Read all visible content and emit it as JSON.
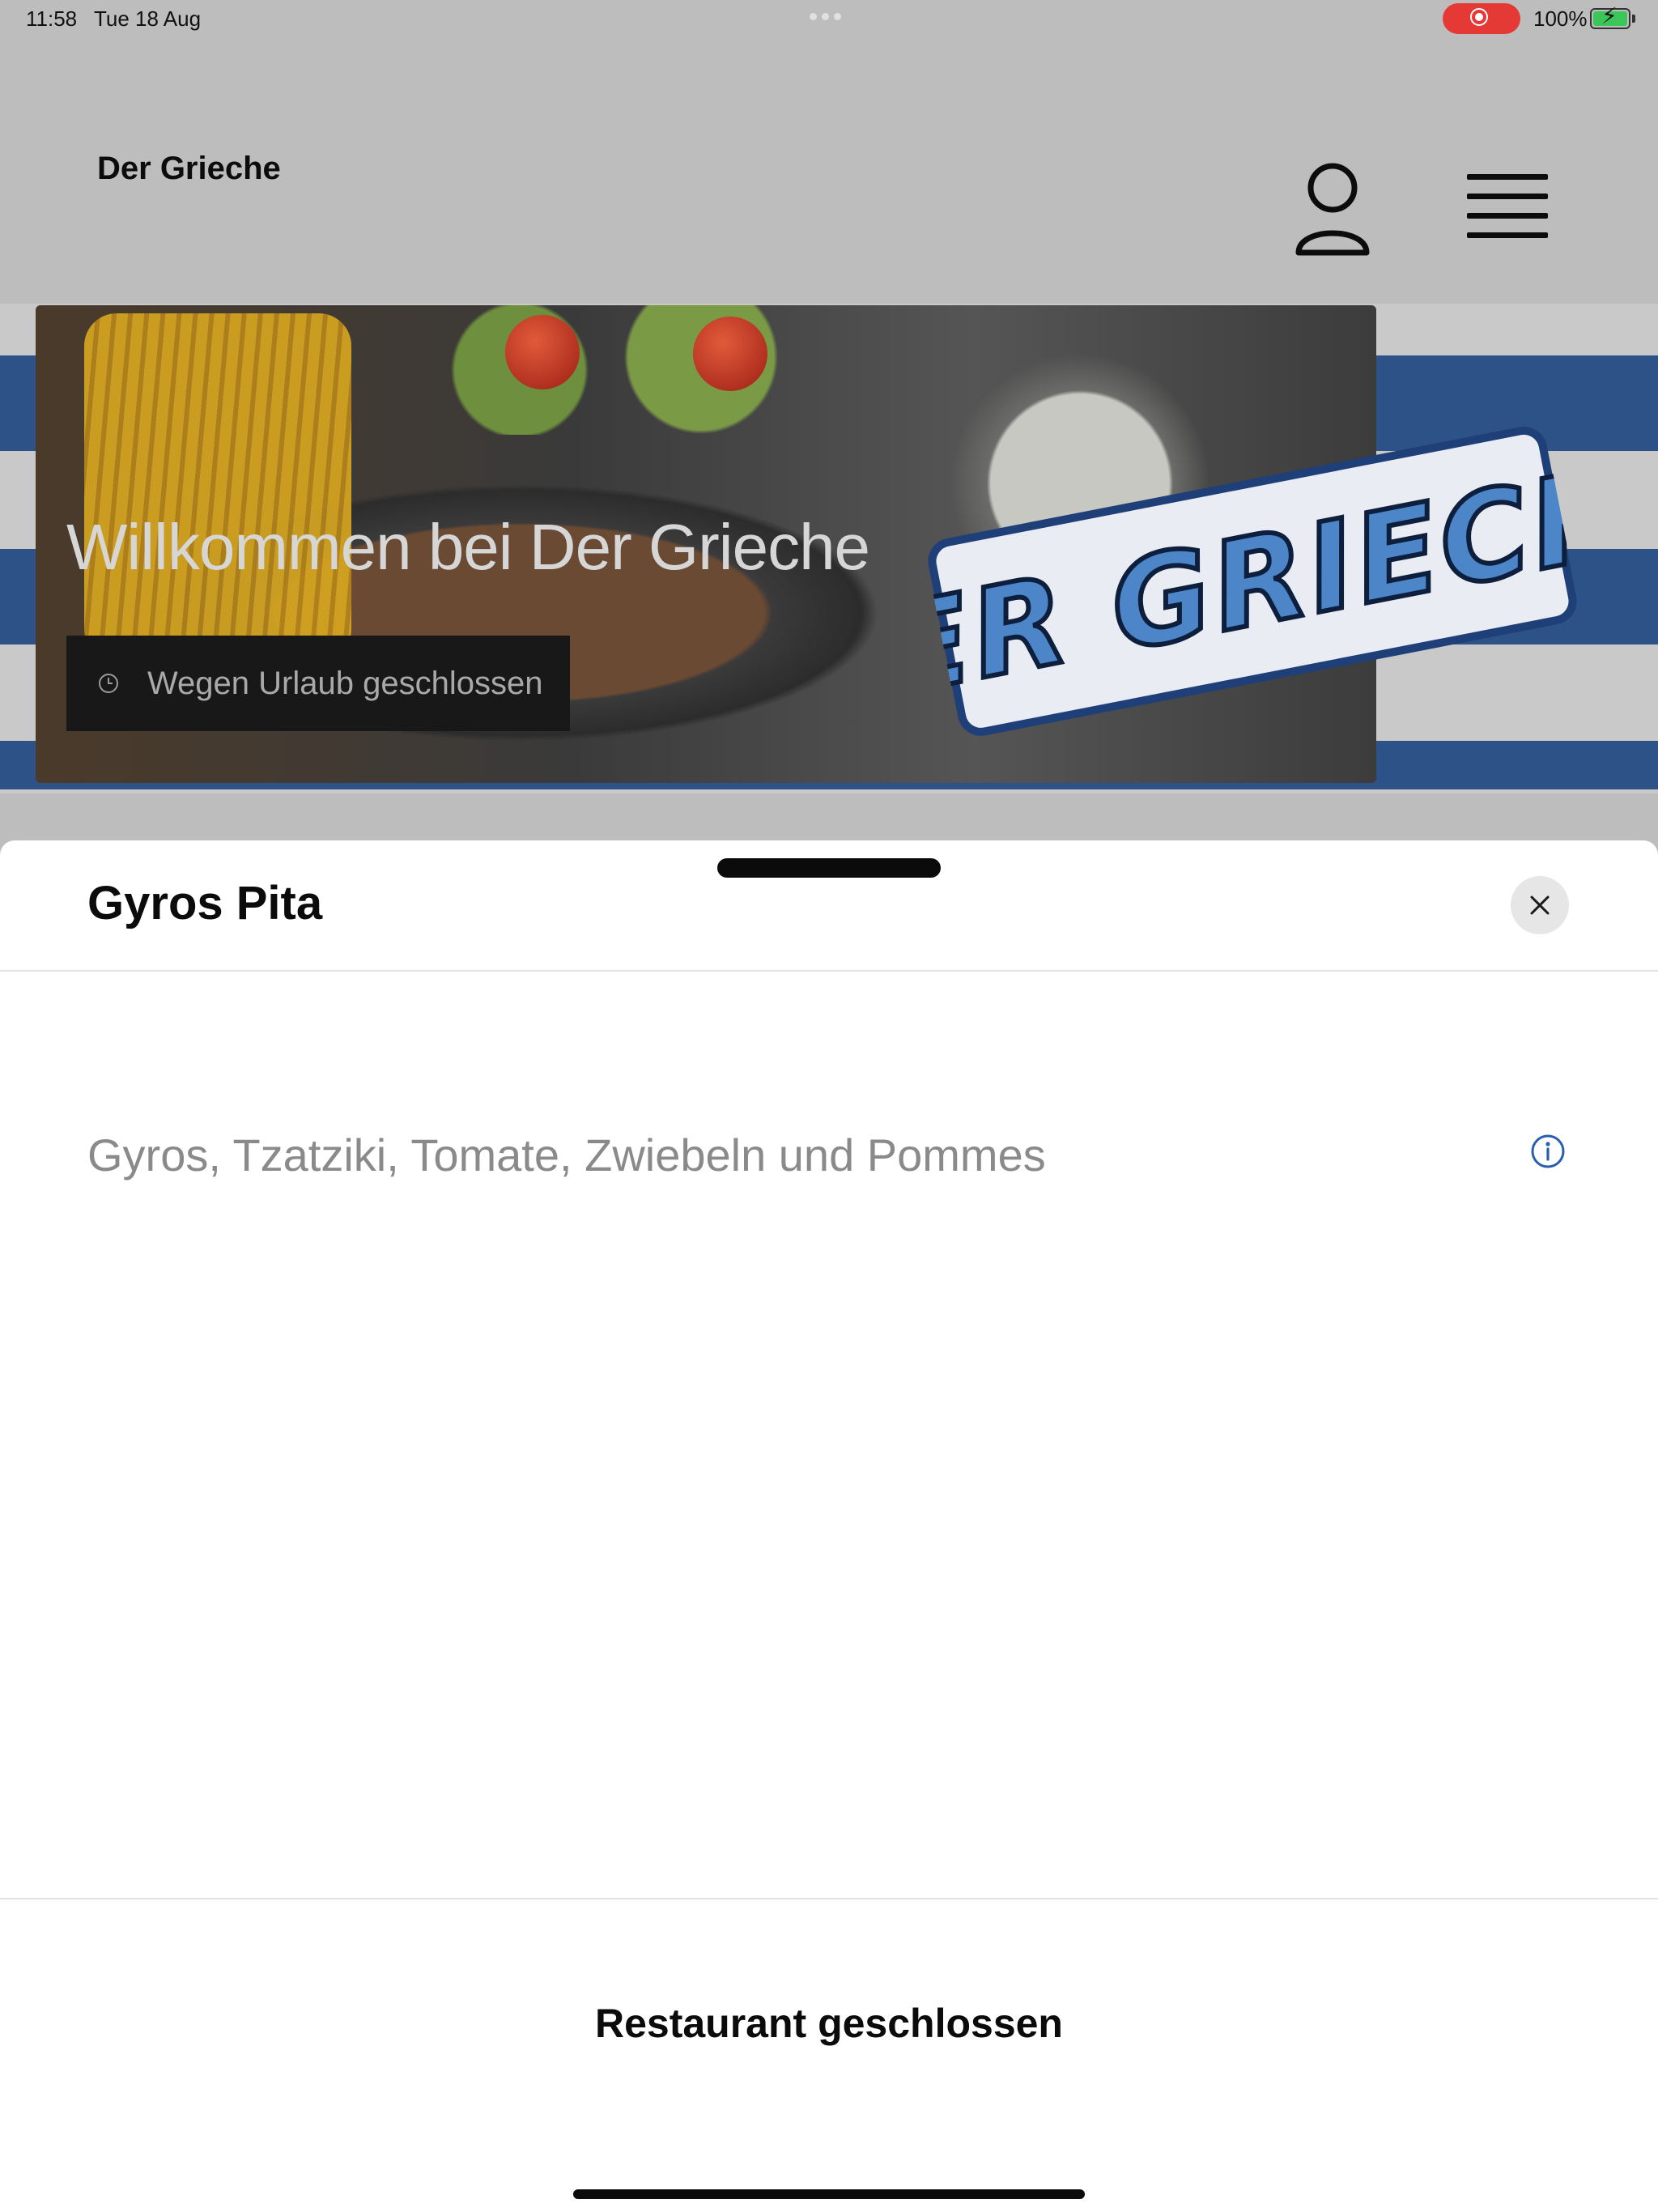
{
  "status_bar": {
    "time": "11:58",
    "date": "Tue 18 Aug",
    "battery_percent": "100%",
    "battery_level": 1.0,
    "charging": true,
    "screen_recording": true
  },
  "header": {
    "brand": "Der Grieche",
    "account_icon": "person-icon",
    "menu_icon": "hamburger-icon"
  },
  "hero": {
    "welcome": "Willkommen bei Der Grieche",
    "closed_notice": "Wegen Urlaub geschlossen",
    "logo_text": "DER GRIECHE",
    "clock_icon": "clock-icon"
  },
  "sheet": {
    "title": "Gyros Pita",
    "close_icon": "close-icon",
    "description": "Gyros, Tzatziki, Tomate, Zwiebeln und Pommes",
    "info_icon": "info-icon",
    "footer_label": "Restaurant geschlossen"
  },
  "colors": {
    "stripe_blue": "#2c5288",
    "dim_overlay": "#bdbdbd",
    "accent_info": "#2a5fb0",
    "recording_red": "#e53935"
  }
}
